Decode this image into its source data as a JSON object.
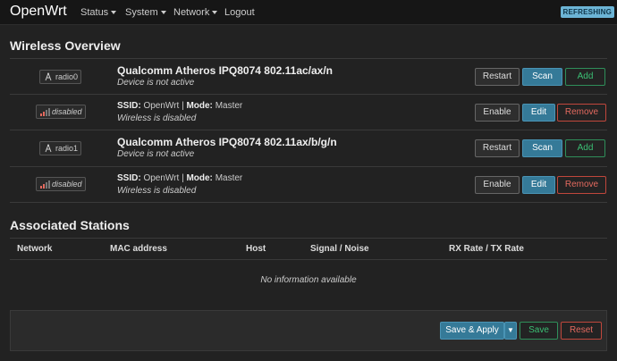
{
  "nav": {
    "brand": "OpenWrt",
    "items": [
      {
        "label": "Status",
        "dropdown": true
      },
      {
        "label": "System",
        "dropdown": true
      },
      {
        "label": "Network",
        "dropdown": true
      },
      {
        "label": "Logout",
        "dropdown": false
      }
    ],
    "status_badge": "REFRESHING"
  },
  "wireless": {
    "title": "Wireless Overview",
    "radios": [
      {
        "badge": "radio0",
        "device_title": "Qualcomm Atheros IPQ8074 802.11ac/ax/n",
        "device_status": "Device is not active",
        "buttons": {
          "restart": "Restart",
          "scan": "Scan",
          "add": "Add"
        },
        "network": {
          "badge": "disabled",
          "ssid_label": "SSID:",
          "ssid": "OpenWrt",
          "mode_label": "Mode:",
          "mode": "Master",
          "status": "Wireless is disabled",
          "buttons": {
            "enable": "Enable",
            "edit": "Edit",
            "remove": "Remove"
          }
        }
      },
      {
        "badge": "radio1",
        "device_title": "Qualcomm Atheros IPQ8074 802.11ax/b/g/n",
        "device_status": "Device is not active",
        "buttons": {
          "restart": "Restart",
          "scan": "Scan",
          "add": "Add"
        },
        "network": {
          "badge": "disabled",
          "ssid_label": "SSID:",
          "ssid": "OpenWrt",
          "mode_label": "Mode:",
          "mode": "Master",
          "status": "Wireless is disabled",
          "buttons": {
            "enable": "Enable",
            "edit": "Edit",
            "remove": "Remove"
          }
        }
      }
    ]
  },
  "stations": {
    "title": "Associated Stations",
    "columns": [
      "Network",
      "MAC address",
      "Host",
      "Signal / Noise",
      "RX Rate / TX Rate"
    ],
    "empty_text": "No information available"
  },
  "footer": {
    "save_apply": "Save & Apply",
    "save": "Save",
    "reset": "Reset"
  },
  "colors": {
    "primary": "#357a98",
    "add": "#3bbf74",
    "remove": "#e36a5f",
    "badge": "#6cb4d5"
  },
  "icons": {
    "radio": "radio-antenna-icon",
    "signal_disabled": "signal-disabled-icon",
    "dropdown": "chevron-down-icon"
  }
}
